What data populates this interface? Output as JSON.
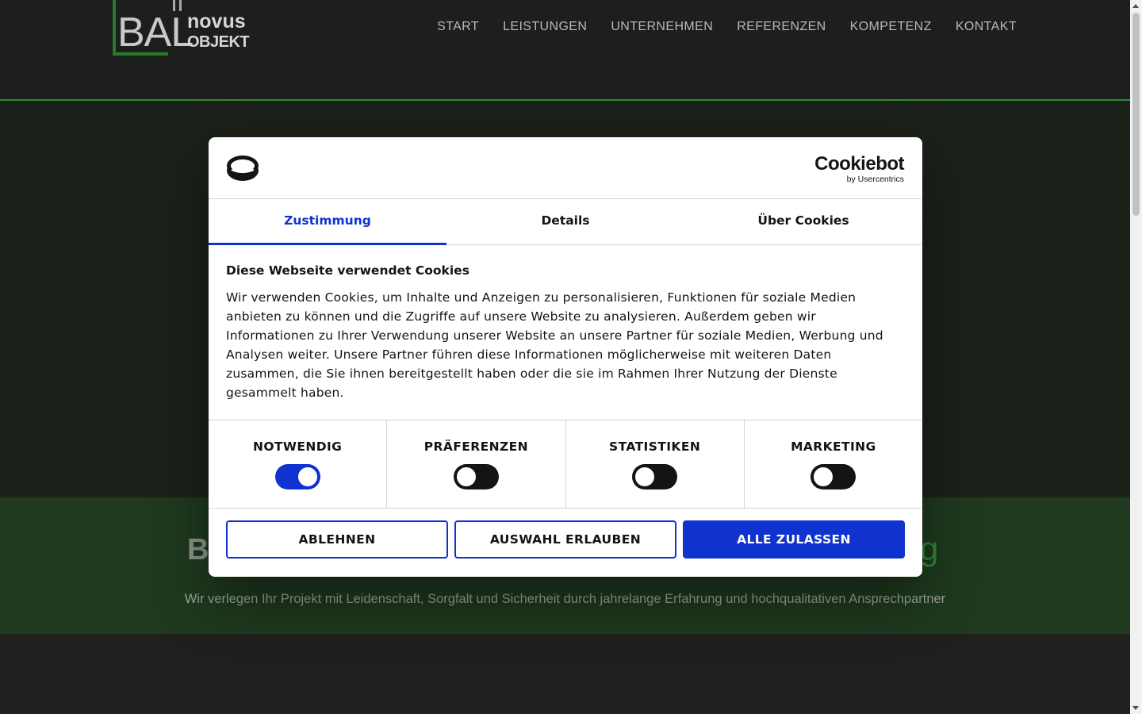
{
  "site": {
    "logo": {
      "big": "BAL",
      "top": "novus",
      "bottom": "OBJEKT"
    },
    "nav": [
      {
        "label": "START"
      },
      {
        "label": "LEISTUNGEN"
      },
      {
        "label": "UNTERNEHMEN"
      },
      {
        "label": "REFERENZEN"
      },
      {
        "label": "KOMPETENZ"
      },
      {
        "label": "KONTAKT"
      }
    ],
    "band": {
      "title_left_visible": "B",
      "title_right_visible": "g",
      "subtitle": "Wir verlegen Ihr Projekt mit Leidenschaft, Sorgfalt und Sicherheit durch jahrelange Erfahrung und hochqualitativen Ansprechpartner"
    }
  },
  "cookie_dialog": {
    "brand": {
      "name": "Cookiebot",
      "by": "by Usercentrics"
    },
    "tabs": [
      {
        "label": "Zustimmung",
        "active": true
      },
      {
        "label": "Details",
        "active": false
      },
      {
        "label": "Über Cookies",
        "active": false
      }
    ],
    "heading": "Diese Webseite verwendet Cookies",
    "body": "Wir verwenden Cookies, um Inhalte und Anzeigen zu personalisieren, Funktionen für soziale Medien anbieten zu können und die Zugriffe auf unsere Website zu analysieren. Außerdem geben wir Informationen zu Ihrer Verwendung unserer Website an unsere Partner für soziale Medien, Werbung und Analysen weiter. Unsere Partner führen diese Informationen möglicherweise mit weiteren Daten zusammen, die Sie ihnen bereitgestellt haben oder die sie im Rahmen Ihrer Nutzung der Dienste gesammelt haben.",
    "categories": [
      {
        "label": "NOTWENDIG",
        "enabled": true
      },
      {
        "label": "PRÄFERENZEN",
        "enabled": false
      },
      {
        "label": "STATISTIKEN",
        "enabled": false
      },
      {
        "label": "MARKETING",
        "enabled": false
      }
    ],
    "buttons": {
      "decline": "ABLEHNEN",
      "allow_selection": "AUSWAHL ERLAUBEN",
      "allow_all": "ALLE ZULASSEN"
    }
  },
  "colors": {
    "accent": "#1032cf",
    "site_green": "#2e8b34",
    "site_bg": "#1f211e"
  }
}
